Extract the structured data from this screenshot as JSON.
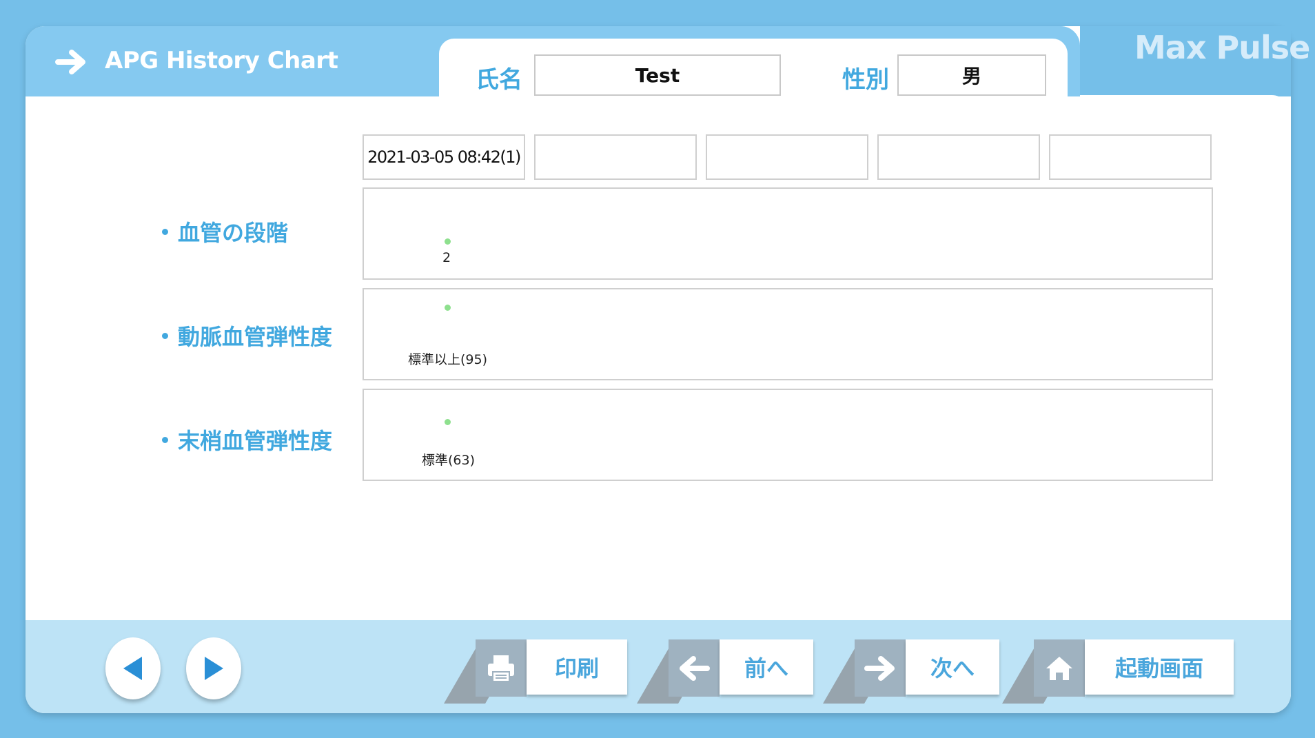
{
  "header": {
    "title": "APG History Chart",
    "brand": "Max Pulse"
  },
  "patient": {
    "name_label": "氏名",
    "name_value": "Test",
    "gender_label": "性別",
    "gender_value": "男"
  },
  "dates": [
    "2021-03-05 08:42(1)",
    "",
    "",
    "",
    ""
  ],
  "rows": [
    {
      "label": "血管の段階",
      "value_text": "2"
    },
    {
      "label": "動脈血管弾性度",
      "value_text": "標準以上(95)"
    },
    {
      "label": "末梢血管弾性度",
      "value_text": "標準(63)"
    }
  ],
  "footer": {
    "print_label": "印刷",
    "prev_label": "前へ",
    "next_label": "次へ",
    "home_label": "起動画面"
  },
  "colors": {
    "background": "#75bfe9",
    "accent_text": "#41a8df",
    "marker": "#8ee08e",
    "footer": "#bde3f6"
  },
  "icons": [
    "arrow-right-icon",
    "triangle-left-icon",
    "triangle-right-icon",
    "printer-icon",
    "arrow-left-icon",
    "home-icon"
  ]
}
